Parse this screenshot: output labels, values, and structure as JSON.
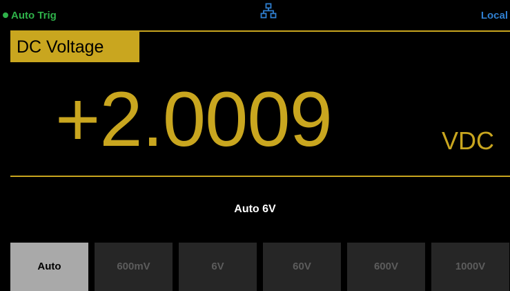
{
  "status": {
    "trigger_text": "Auto  Trig",
    "lan_icon": "lan-network-icon",
    "remote_text": "Local",
    "trigger_color": "#2fb24a",
    "remote_color": "#2f7fd0"
  },
  "function_label": "DC Voltage",
  "reading": {
    "value": "+2.0009",
    "unit": "VDC"
  },
  "range_status": "Auto  6V",
  "softkeys": [
    {
      "label": "Auto",
      "active": true
    },
    {
      "label": "600mV",
      "active": false
    },
    {
      "label": "6V",
      "active": false
    },
    {
      "label": "60V",
      "active": false
    },
    {
      "label": "600V",
      "active": false
    },
    {
      "label": "1000V",
      "active": false
    }
  ],
  "colors": {
    "accent": "#c9a61f",
    "background": "#000000",
    "softkey_bg": "#262626",
    "softkey_active_bg": "#a9a9a9"
  }
}
